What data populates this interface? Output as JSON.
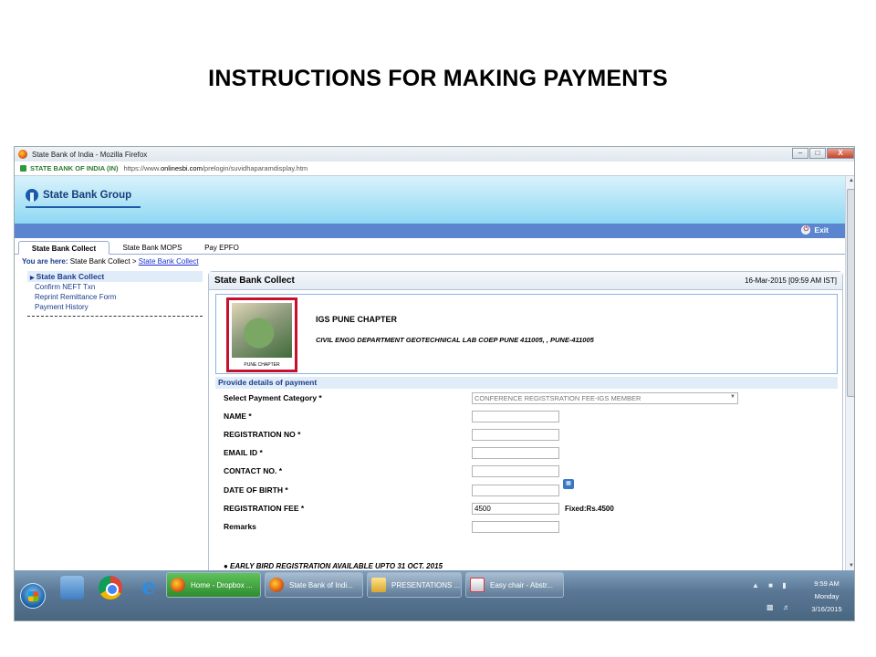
{
  "slide": {
    "title": "INSTRUCTIONS FOR MAKING PAYMENTS"
  },
  "browser": {
    "window_title": "State Bank of India - Mozilla Firefox",
    "site_identity": "STATE BANK OF INDIA (IN)",
    "url_prefix": "https://www.",
    "url_domain": "onlinesbi.com",
    "url_path": "/prelogin/suvidhaparamdisplay.htm",
    "window_buttons": {
      "minimize": "–",
      "maximize": "□",
      "close": "X"
    }
  },
  "page": {
    "brand": "State Bank Group",
    "exit_label": "Exit",
    "tabs": [
      {
        "label": "State Bank Collect",
        "active": true
      },
      {
        "label": "State Bank MOPS",
        "active": false
      },
      {
        "label": "Pay EPFO",
        "active": false
      }
    ],
    "breadcrumb": {
      "prefix": "You are here:",
      "parent": "State Bank Collect >",
      "current": "State Bank Collect"
    },
    "left_nav": {
      "heading": "State Bank Collect",
      "items": [
        "Confirm NEFT Txn",
        "Reprint Remittance Form",
        "Payment History"
      ]
    },
    "main": {
      "title": "State Bank Collect",
      "date": "16-Mar-2015 [09:59 AM IST]",
      "org_logo_caption": "PUNE CHAPTER",
      "org_name": "IGS PUNE CHAPTER",
      "org_address": "CIVIL ENGG DEPARTMENT GEOTECHNICAL LAB COEP PUNE 411005, , PUNE-411005",
      "section_heading": "Provide details of payment",
      "fields": {
        "category_label": "Select Payment Category *",
        "category_value": "CONFERENCE REGISTSRATION FEE-IGS MEMBER",
        "name_label": "NAME *",
        "name_value": "",
        "regno_label": "REGISTRATION NO *",
        "regno_value": "",
        "email_label": "EMAIL ID *",
        "email_value": "",
        "contact_label": "CONTACT NO. *",
        "contact_value": "",
        "dob_label": "DATE OF BIRTH *",
        "dob_value": "",
        "fee_label": "REGISTRATION FEE *",
        "fee_value": "4500",
        "fee_note": "Fixed:Rs.4500",
        "remarks_label": "Remarks",
        "remarks_value": ""
      },
      "note": "●  EARLY BIRD REGISTRATION AVAILABLE UPTO 31 OCT. 2015"
    }
  },
  "taskbar": {
    "tasks": [
      {
        "label": "Home - Dropbox ...",
        "icon": "firefox-icon",
        "active": true
      },
      {
        "label": "State Bank of Indi...",
        "icon": "firefox-icon",
        "active": false
      },
      {
        "label": "PRESENTATIONS ...",
        "icon": "folder-icon",
        "active": false
      },
      {
        "label": "Easy chair - Abstr...",
        "icon": "document-icon",
        "active": false
      }
    ],
    "clock": {
      "time": "9:59 AM",
      "day": "Monday",
      "date": "3/16/2015"
    }
  }
}
